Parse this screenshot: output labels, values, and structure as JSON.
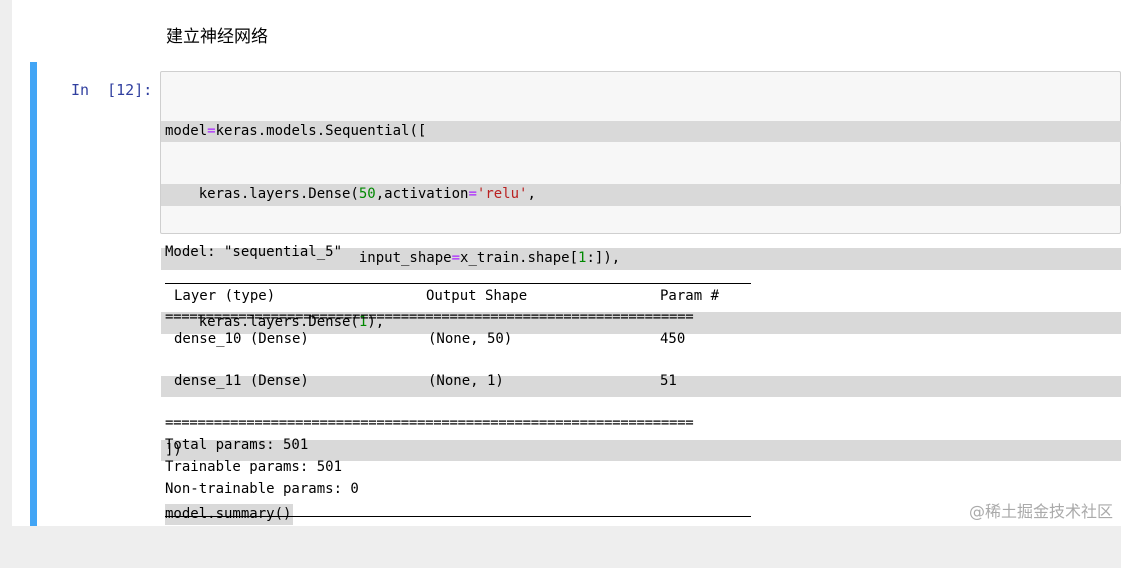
{
  "markdown": {
    "text": "建立神经网络"
  },
  "cell": {
    "prompt": "In  [12]:",
    "code": {
      "line1": {
        "a": "model",
        "op": "=",
        "b": "keras.models.Sequential(["
      },
      "line2": {
        "a": "    keras.layers.Dense(",
        "n": "50",
        "b": ",activation",
        "op": "=",
        "s": "'relu'",
        "c": ","
      },
      "line3": {
        "a": "                       input_shape",
        "op": "=",
        "b": "x_train.shape[",
        "n": "1",
        "c": ":]),"
      },
      "line4": {
        "a": "    keras.layers.Dense(",
        "n": "1",
        "b": "),"
      },
      "line5": "",
      "line6": "])",
      "line7": "model.summary()"
    }
  },
  "output": {
    "model_title": "Model: \"sequential_5\"",
    "headers": {
      "layer": "Layer (type)",
      "shape": "Output Shape",
      "params": "Param #"
    },
    "separator": "=================================================================",
    "rows": [
      {
        "layer": "dense_10 (Dense)",
        "shape": "(None, 50)",
        "params": "450"
      },
      {
        "layer": "dense_11 (Dense)",
        "shape": "(None, 1)",
        "params": "51"
      }
    ],
    "total": "Total params: 501",
    "trainable": "Trainable params: 501",
    "non_trainable": "Non-trainable params: 0"
  },
  "watermark": "@稀土掘金技术社区",
  "colors": {
    "cell_bar": "#42a5f5",
    "prompt": "#303f9f",
    "number": "#008800",
    "string": "#ba2121",
    "operator": "#aa22ff"
  }
}
